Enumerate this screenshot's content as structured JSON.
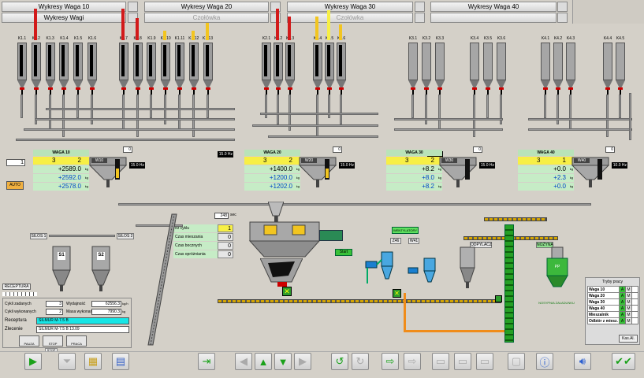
{
  "top_buttons": [
    {
      "label": "Wykresy Waga 10",
      "enabled": true
    },
    {
      "label": "Wykresy Waga 20",
      "enabled": true
    },
    {
      "label": "Wykresy Waga 30",
      "enabled": true
    },
    {
      "label": "Wykresy Waga 40",
      "enabled": true
    },
    {
      "label": "Wykresy Wagi",
      "enabled": true
    },
    {
      "label": "Czołówka",
      "enabled": false
    },
    {
      "label": "Czołówka",
      "enabled": false
    },
    {
      "label": "",
      "enabled": false
    }
  ],
  "silos": {
    "g1": [
      "K1.1",
      "K1.2",
      "K1.3",
      "K1.4",
      "K1.5",
      "K1.6",
      "K1.7",
      "K1.8",
      "K1.9",
      "K1.10",
      "K1.11",
      "K1.12",
      "K1.13"
    ],
    "g2": [
      "K2.1",
      "K2.2",
      "K2.3",
      "K2.4",
      "K2.5",
      "K2.6"
    ],
    "g3": [
      "K3.1",
      "K3.2",
      "K3.3",
      "K3.4",
      "K3.5",
      "K3.6"
    ],
    "g4": [
      "K4.1",
      "K4.2",
      "K4.3",
      "K4.4",
      "K4.5"
    ]
  },
  "scales": [
    {
      "title": "WAGA 10",
      "a": "3",
      "b": "2",
      "v1": "+2589.0",
      "v2": "+2592.0",
      "v3": "+2578.0",
      "unit": "kg",
      "freq": "15.0 Hz",
      "freq2": "15.0 Hz",
      "code": "W10"
    },
    {
      "title": "WAGA 20",
      "a": "3",
      "b": "2",
      "v1": "+1400.0",
      "v2": "+1200.0",
      "v3": "+1202.0",
      "unit": "kg",
      "freq": "15.0 Hz",
      "freq2": "15.0 Hz",
      "code": "W20"
    },
    {
      "title": "WAGA 30",
      "a": "3",
      "b": "2",
      "v1": "+8.2",
      "v2": "+8.0",
      "v3": "+8.2",
      "unit": "kg",
      "freq": "15.0 Hz",
      "freq2": "",
      "code": "W30"
    },
    {
      "title": "WAGA 40",
      "a": "3",
      "b": "1",
      "v1": "+0.0",
      "v2": "+2.3",
      "v3": "+0.0",
      "unit": "kg",
      "freq": "10.0 Hz",
      "freq2": "",
      "code": "W40"
    }
  ],
  "left_misc": {
    "field_value": "1",
    "auto_label": "AUTO"
  },
  "zeros": {
    "w10": "0",
    "w20": "0",
    "w30": "0",
    "w40": "0"
  },
  "cycle": {
    "timer": "248",
    "timer_unit": "sec",
    "rows": [
      {
        "label": "Nr cyklu",
        "value": "1"
      },
      {
        "label": "Czas mieszania",
        "value": "0"
      },
      {
        "label": "Czas bocznych",
        "value": "0"
      },
      {
        "label": "Czas opróżniania",
        "value": "0"
      }
    ]
  },
  "silos_bottom": {
    "silos1": "SILOS 1",
    "silos2": "SILOS 2",
    "s1": "S1",
    "s2": "S2"
  },
  "receptura": {
    "tab": "RECEPTURA",
    "cykli_zadanych_label": "Cykli zadanych",
    "cykli_zadanych": "3",
    "wydajnosc_label": "Wydajność",
    "wydajnosc": "62556.3",
    "wydajnosc_unit": "kg/h",
    "cykli_wykonanych_label": "Cykli wykonanych",
    "cykli_wykonanych": "2",
    "masa_label": "Masa wykonana",
    "masa": "7990.3",
    "masa_unit": "kg",
    "receptura_label": "Receptura",
    "receptura_value": "SILMUR M-7.5 B",
    "zlecenie_label": "Zlecenie",
    "zlecenie_value": "SILMUR M-7.5 B 13.09",
    "btn_pauza": "PAUZA",
    "btn_stop": "STOP",
    "btn_prace": "PRACA",
    "stop_label": "STOP"
  },
  "mixer": {
    "start_label": "Start",
    "wentylatory": "WENTYLATORY",
    "fan1": "Z46",
    "fan2": "W41",
    "big_label": "NOSTAL OBAL"
  },
  "bagging": {
    "odpylacz": "ODPYLACZ",
    "nozyna": "NOŻYNA",
    "label": "NOSYPNIA ZAŁADUNKU",
    "pp": "PP"
  },
  "tryby": {
    "title": "Tryby pracy",
    "rows": [
      {
        "label": "Waga 10",
        "a": "A",
        "m": "M"
      },
      {
        "label": "Waga 20",
        "a": "A",
        "m": "M"
      },
      {
        "label": "Waga 30",
        "a": "A",
        "m": "M"
      },
      {
        "label": "Waga 40",
        "a": "A",
        "m": "M"
      },
      {
        "label": "Mieszalnik",
        "a": "A",
        "m": "M"
      },
      {
        "label": "Odbiór z miesz.",
        "a": "A",
        "m": "M"
      }
    ],
    "btn": "Kas.Al."
  },
  "colors": {
    "accent_green": "#1aa11a",
    "yellow": "#f7ef45",
    "scale_bg": "#c6ecc6",
    "blue_value": "#0045c8",
    "red_level": "#d21a1a"
  }
}
